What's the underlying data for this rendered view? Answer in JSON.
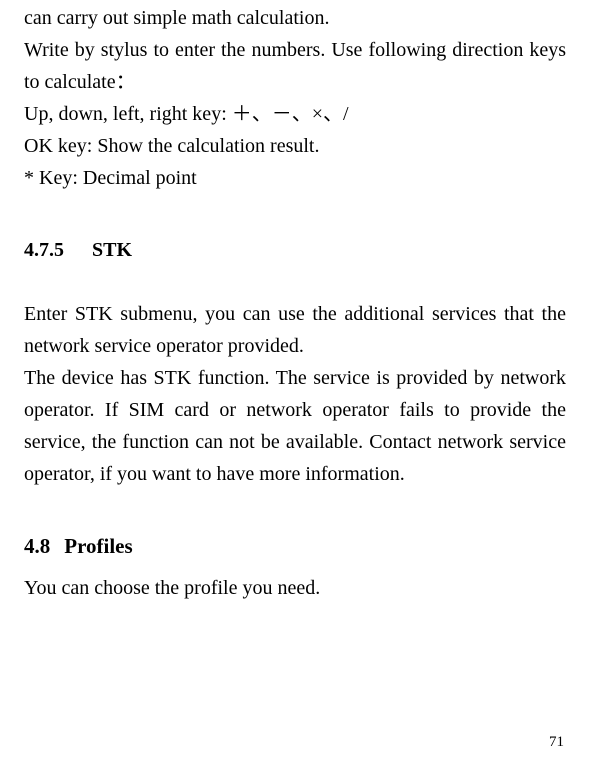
{
  "intro": {
    "p1": "can carry out simple math calculation.",
    "p2": "Write by stylus to enter the numbers. Use following direction keys to calculate：",
    "p3": "Up, down, left, right key:  ＋、－、×、/",
    "p4": "OK key: Show the calculation result.",
    "p5": "* Key: Decimal point"
  },
  "s475": {
    "num": "4.7.5",
    "title": "STK",
    "p1": "Enter STK submenu, you can use the additional services that the network service operator provided.",
    "p2": "The device has STK function. The service is provided by network operator. If SIM card or network operator fails to provide the service, the function can not be available. Contact network service operator, if you want to have more information."
  },
  "s48": {
    "num": "4.8",
    "title": "Profiles",
    "p1": "You can choose the profile you need."
  },
  "pageNumber": "71"
}
